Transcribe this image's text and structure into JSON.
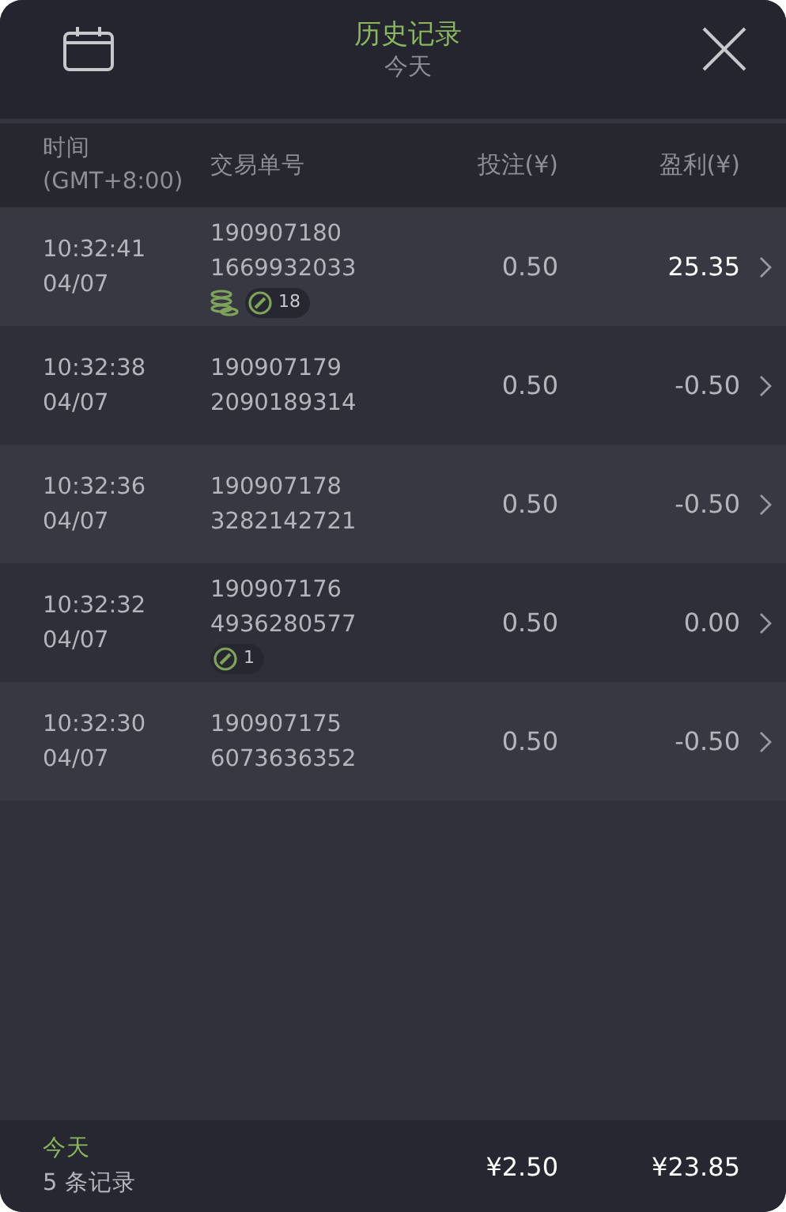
{
  "header": {
    "title": "历史记录",
    "subtitle": "今天"
  },
  "columns": {
    "time": "时间",
    "timezone": "(GMT+8:00)",
    "order": "交易单号",
    "stake": "投注(¥)",
    "profit": "盈利(¥)"
  },
  "rows": [
    {
      "time": "10:32:41",
      "date": "04/07",
      "order_a": "190907180",
      "order_b": "1669932033",
      "stake": "0.50",
      "profit": "25.35",
      "won": true,
      "badges": [
        {
          "kind": "coins"
        },
        {
          "kind": "count",
          "text": "18"
        }
      ]
    },
    {
      "time": "10:32:38",
      "date": "04/07",
      "order_a": "190907179",
      "order_b": "2090189314",
      "stake": "0.50",
      "profit": "-0.50",
      "won": false,
      "badges": []
    },
    {
      "time": "10:32:36",
      "date": "04/07",
      "order_a": "190907178",
      "order_b": "3282142721",
      "stake": "0.50",
      "profit": "-0.50",
      "won": false,
      "badges": []
    },
    {
      "time": "10:32:32",
      "date": "04/07",
      "order_a": "190907176",
      "order_b": "4936280577",
      "stake": "0.50",
      "profit": "0.00",
      "won": false,
      "badges": [
        {
          "kind": "count",
          "text": "1"
        }
      ]
    },
    {
      "time": "10:32:30",
      "date": "04/07",
      "order_a": "190907175",
      "order_b": "6073636352",
      "stake": "0.50",
      "profit": "-0.50",
      "won": false,
      "badges": []
    }
  ],
  "footer": {
    "period": "今天",
    "count": "5 条记录",
    "stake_total": "¥2.50",
    "profit_total": "¥23.85"
  }
}
